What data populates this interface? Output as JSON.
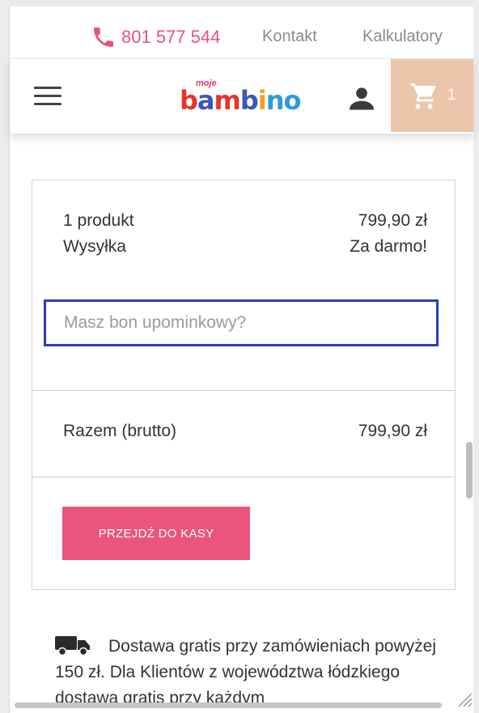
{
  "topbar": {
    "phone": "801 577 544",
    "contact": "Kontakt",
    "calculators": "Kalkulatory"
  },
  "header": {
    "logo_small": "moje",
    "logo_word": [
      "b",
      "a",
      "m",
      "b",
      "i",
      "no"
    ],
    "cart_count": "1"
  },
  "summary": {
    "products_label": "1 produkt",
    "products_value": "799,90 zł",
    "shipping_label": "Wysyłka",
    "shipping_value": "Za darmo!",
    "voucher_placeholder": "Masz bon upominkowy?",
    "total_label": "Razem (brutto)",
    "total_value": "799,90 zł",
    "checkout_label": "PRZEJDŹ DO KASY"
  },
  "shipping_info": {
    "text": "Dostawa gratis przy zamówieniach powyżej 150 zł. Dla Klientów z województwa łódzkiego dostawa gratis przy każdym"
  },
  "colors": {
    "accent": "#eb557c",
    "cart_bg": "#ebc6aa",
    "focus_border": "#2c3db8"
  },
  "icons": {
    "phone": "phone-icon",
    "menu": "hamburger-menu-icon",
    "user": "user-icon",
    "cart": "shopping-cart-icon",
    "truck": "delivery-truck-icon"
  }
}
